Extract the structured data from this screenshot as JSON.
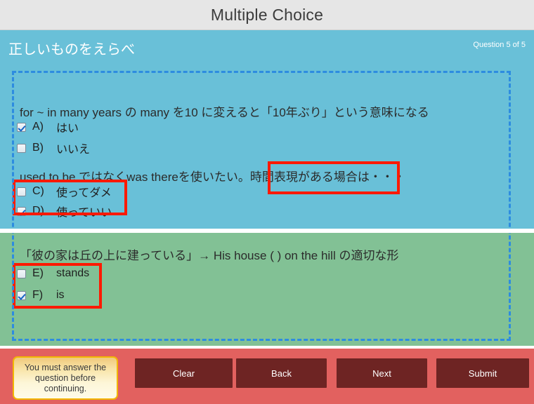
{
  "window": {
    "title": "Multiple Choice"
  },
  "header": {
    "question_title": "正しいものをえらべ",
    "counter": "Question 5 of 5",
    "accent_color": "#69c0d8"
  },
  "panes": {
    "blue_color": "#69c0d8",
    "green_color": "#82c195"
  },
  "questions": [
    {
      "prompt": "for ~ in many years の many を10 に変えると「10年ぶり」という意味になる",
      "options": [
        {
          "letter": "A)",
          "label": "はい",
          "checked": true
        },
        {
          "letter": "B)",
          "label": "いいえ",
          "checked": false
        }
      ]
    },
    {
      "prompt": "used to be ではなくwas thereを使いたい。時間表現がある場合は・・・",
      "options": [
        {
          "letter": "C)",
          "label": "使ってダメ",
          "checked": false
        },
        {
          "letter": "D)",
          "label": "使っていい",
          "checked": true
        }
      ]
    },
    {
      "prompt": "「彼の家は丘の上に建っている」→ His house (      ) on the hill の適切な形",
      "options": [
        {
          "letter": "E)",
          "label": "stands",
          "checked": false
        },
        {
          "letter": "F)",
          "label": "is",
          "checked": true
        }
      ]
    }
  ],
  "annotations": {
    "highlight_color": "#ff1a00",
    "boxes": [
      {
        "name": "highlight-options-cd"
      },
      {
        "name": "highlight-phrase-jikanhyougen"
      },
      {
        "name": "highlight-options-ef"
      }
    ]
  },
  "footer": {
    "background_color": "#e2615f",
    "warning": "You must answer the question before continuing.",
    "buttons": [
      {
        "label": "Clear"
      },
      {
        "label": "Back"
      },
      {
        "label": "Next"
      },
      {
        "label": "Submit"
      }
    ]
  }
}
